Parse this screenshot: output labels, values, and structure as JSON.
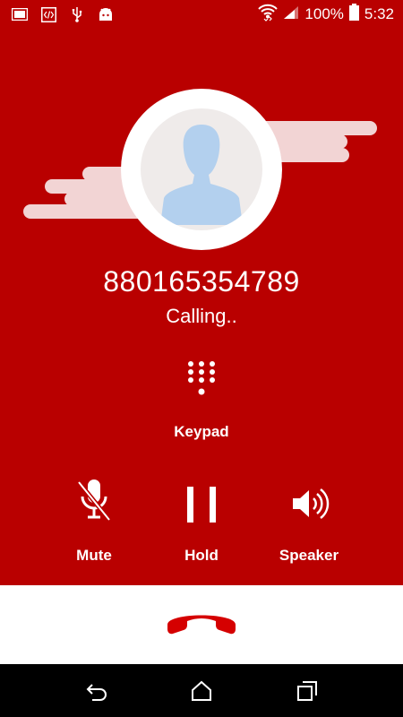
{
  "status_bar": {
    "battery_text": "100%",
    "time": "5:32",
    "icons_left": [
      "gmail-icon",
      "code-icon",
      "usb-icon",
      "android-icon"
    ],
    "icons_right": [
      "wifi-icon",
      "signal-icon",
      "battery-icon"
    ]
  },
  "call": {
    "number": "880165354789",
    "status": "Calling.."
  },
  "controls": {
    "keypad_label": "Keypad",
    "mute_label": "Mute",
    "hold_label": "Hold",
    "speaker_label": "Speaker"
  },
  "colors": {
    "primary": "#b90000",
    "end_call": "#d50000",
    "avatar_bg": "#efebea",
    "avatar_silhouette": "#b3d0ee"
  }
}
